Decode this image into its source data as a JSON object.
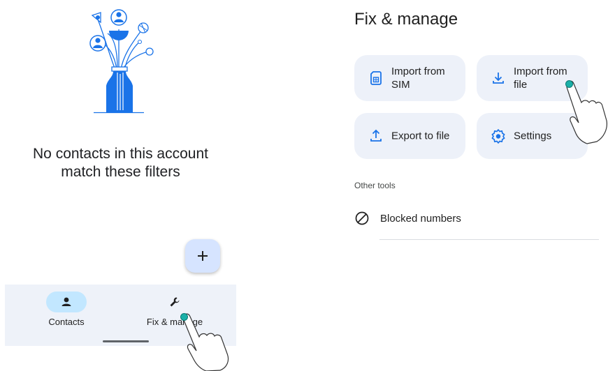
{
  "left": {
    "empty_message_line1": "No contacts in this account",
    "empty_message_line2": "match these filters",
    "fab_label": "+",
    "nav": {
      "contacts_label": "Contacts",
      "fix_manage_label": "Fix & manage",
      "active": "contacts"
    }
  },
  "right": {
    "title": "Fix & manage",
    "tiles": [
      {
        "label": "Import from SIM",
        "icon": "sim-card-icon"
      },
      {
        "label": "Import from file",
        "icon": "download-icon"
      },
      {
        "label": "Export to file",
        "icon": "upload-icon"
      },
      {
        "label": "Settings",
        "icon": "settings-gear-icon"
      }
    ],
    "other_tools_label": "Other tools",
    "blocked_numbers_label": "Blocked numbers"
  },
  "colors": {
    "accent_blue": "#1a73e8",
    "tile_bg": "#edf1f9",
    "nav_bg": "#eef2f9",
    "nav_active_pill": "#c2e7ff",
    "fab_bg": "#d6e4ff",
    "tap_dot": "#1ab0a8"
  }
}
